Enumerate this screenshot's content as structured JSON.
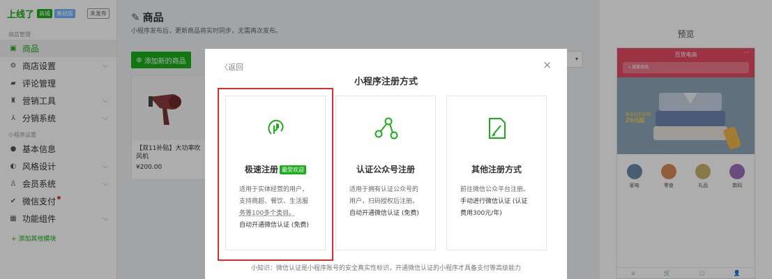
{
  "app": {
    "logo": "上线了",
    "tag1": "商城",
    "tag2": "基础版",
    "status": "未发布"
  },
  "sidebar": {
    "section1": "商店管理",
    "items1": [
      {
        "label": "商品",
        "icon": "shopping-bag-icon",
        "active": true
      },
      {
        "label": "商店设置",
        "icon": "gear-icon",
        "chevron": true
      },
      {
        "label": "评论管理",
        "icon": "comment-icon"
      },
      {
        "label": "营销工具",
        "icon": "gift-icon",
        "chevron": true
      },
      {
        "label": "分销系统",
        "icon": "share-network-icon",
        "chevron": true
      }
    ],
    "section2": "小程序设置",
    "items2": [
      {
        "label": "基本信息",
        "icon": "info-icon"
      },
      {
        "label": "风格设计",
        "icon": "palette-icon",
        "chevron": true
      },
      {
        "label": "会员系统",
        "icon": "users-icon",
        "chevron": true
      },
      {
        "label": "微信支付",
        "icon": "wechat-pay-icon",
        "badge_dot": true
      },
      {
        "label": "功能组件",
        "icon": "grid-icon",
        "chevron": true
      }
    ],
    "add_module": "+ 添加其他模块"
  },
  "main": {
    "title": "商品",
    "subtitle": "小程序发布后，更新商品将实时同步，无需再次发布。",
    "add_button": "添加新的商品",
    "product": {
      "name": "【双11补贴】大功率吹风机",
      "price": "¥200.00"
    }
  },
  "preview": {
    "title": "预览",
    "phone_title": "百货电商",
    "phone_menu": "···",
    "search_placeholder": "搜索商品",
    "banner_line1": "新品衬衫促销",
    "banner_price": "29元起",
    "categories": [
      {
        "label": "家电",
        "color": "#6b88a8"
      },
      {
        "label": "零食",
        "color": "#d98a56"
      },
      {
        "label": "礼品",
        "color": "#c9b36a"
      },
      {
        "label": "数码",
        "color": "#9b6fb8"
      }
    ],
    "tabbar": [
      "⌂",
      "🛒",
      "▢",
      "👤"
    ]
  },
  "modal": {
    "back": "返回",
    "close": "×",
    "title": "小程序注册方式",
    "options": [
      {
        "title": "极速注册",
        "badge": "最受欢迎",
        "desc": [
          "适用于实体经营的用户，",
          "支持商超、餐饮、生活服",
          "务等100多个类目。"
        ],
        "strong": "自动开通微信认证 (免费)"
      },
      {
        "title": "认证公众号注册",
        "desc": [
          "适用于拥有认证公众号的",
          "用户，扫码授权后注册。"
        ],
        "strong": "自动开通微信认证 (免费)"
      },
      {
        "title": "其他注册方式",
        "desc": [
          "前往微信公众平台注册。"
        ],
        "strong_lines": [
          "手动进行微信认证 (认证",
          "费用300元/年)"
        ]
      }
    ],
    "tip": "小知识：微信认证是小程序账号的安全真实性标识，开通微信认证的小程序才具备支付等高级能力"
  },
  "colors": {
    "accent": "#1aad19",
    "highlight": "#e12a2a"
  }
}
